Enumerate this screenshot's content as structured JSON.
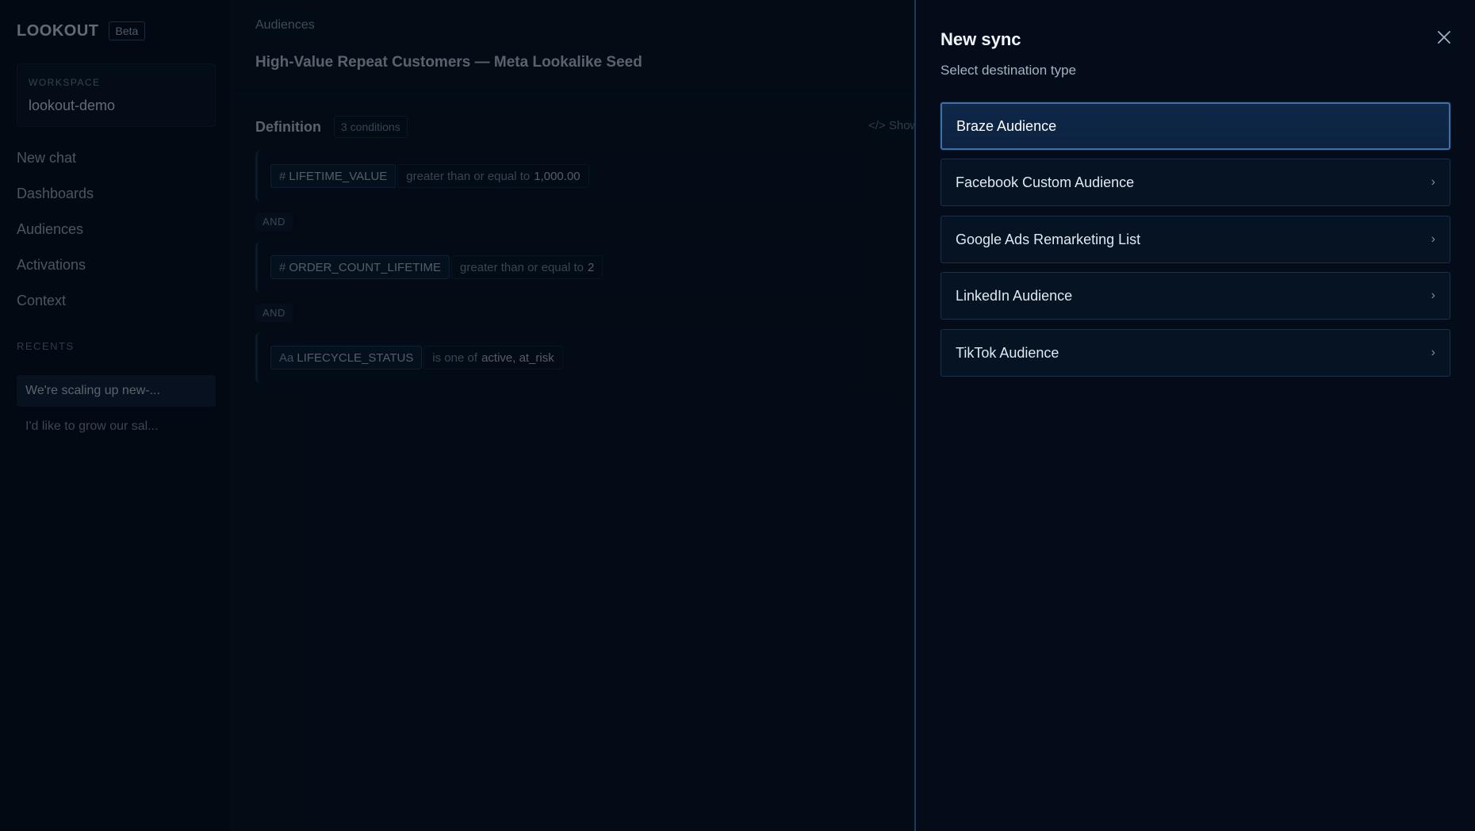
{
  "sidebar": {
    "brand": "LOOKOUT",
    "badge": "Beta",
    "workspace_label": "WORKSPACE",
    "workspace_value": "lookout-demo",
    "nav": [
      "New chat",
      "Dashboards",
      "Audiences",
      "Activations",
      "Context"
    ],
    "recents_label": "RECENTS",
    "recents": [
      "We're scaling up new-...",
      "I'd like to grow our sal..."
    ]
  },
  "main": {
    "breadcrumb": "Audiences",
    "title": "High-Value Repeat Customers — Meta Lookalike Seed",
    "definition_title": "Definition",
    "condition_count": "3 conditions",
    "show_sql": "</> Show",
    "and_label": "AND",
    "conditions": [
      {
        "type_glyph": "#",
        "field": "LIFETIME_VALUE",
        "operator": "greater than or equal to",
        "value": "1,000.00"
      },
      {
        "type_glyph": "#",
        "field": "ORDER_COUNT_LIFETIME",
        "operator": "greater than or equal to",
        "value": "2"
      },
      {
        "type_glyph": "Aa",
        "field": "LIFECYCLE_STATUS",
        "operator": "is one of",
        "value": "active, at_risk"
      }
    ]
  },
  "drawer": {
    "title": "New sync",
    "subtitle": "Select destination type",
    "close_icon": "close-icon",
    "destinations": [
      {
        "label": "Braze Audience",
        "selected": true
      },
      {
        "label": "Facebook Custom Audience",
        "selected": false
      },
      {
        "label": "Google Ads Remarketing List",
        "selected": false
      },
      {
        "label": "LinkedIn Audience",
        "selected": false
      },
      {
        "label": "TikTok Audience",
        "selected": false
      }
    ],
    "chevron_glyph": "›"
  },
  "colors": {
    "background": "#020a14",
    "selected_border": "#3d6fa8",
    "selected_fill": "#0f2848"
  }
}
